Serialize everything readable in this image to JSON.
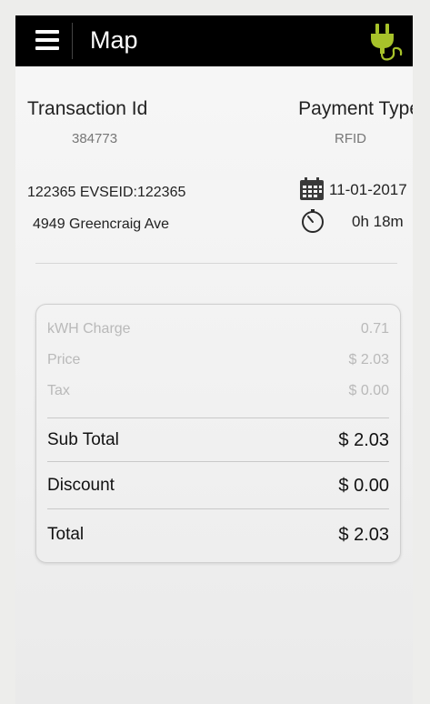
{
  "header": {
    "title": "Map",
    "menu_icon": "hamburger-menu-icon",
    "charger_icon": "ev-plug-icon",
    "charger_icon_color": "#a7c22a"
  },
  "transaction": {
    "id_label": "Transaction Id",
    "id_value": "384773",
    "payment_type_label": "Payment Type",
    "payment_type_value": "RFID",
    "evse_line": "122365 EVSEID:122365",
    "address": "4949 Greencraig Ave",
    "date": "11-01-2017",
    "duration": "0h 18m",
    "date_icon": "calendar-icon",
    "duration_icon": "stopwatch-icon"
  },
  "receipt": {
    "kwh_label": "kWH Charge",
    "kwh_value": "0.71",
    "price_label": "Price",
    "price_value": "$ 2.03",
    "tax_label": "Tax",
    "tax_value": "$ 0.00",
    "subtotal_label": "Sub Total",
    "subtotal_value": "$ 2.03",
    "discount_label": "Discount",
    "discount_value": "$ 0.00",
    "total_label": "Total",
    "total_value": "$ 2.03"
  }
}
